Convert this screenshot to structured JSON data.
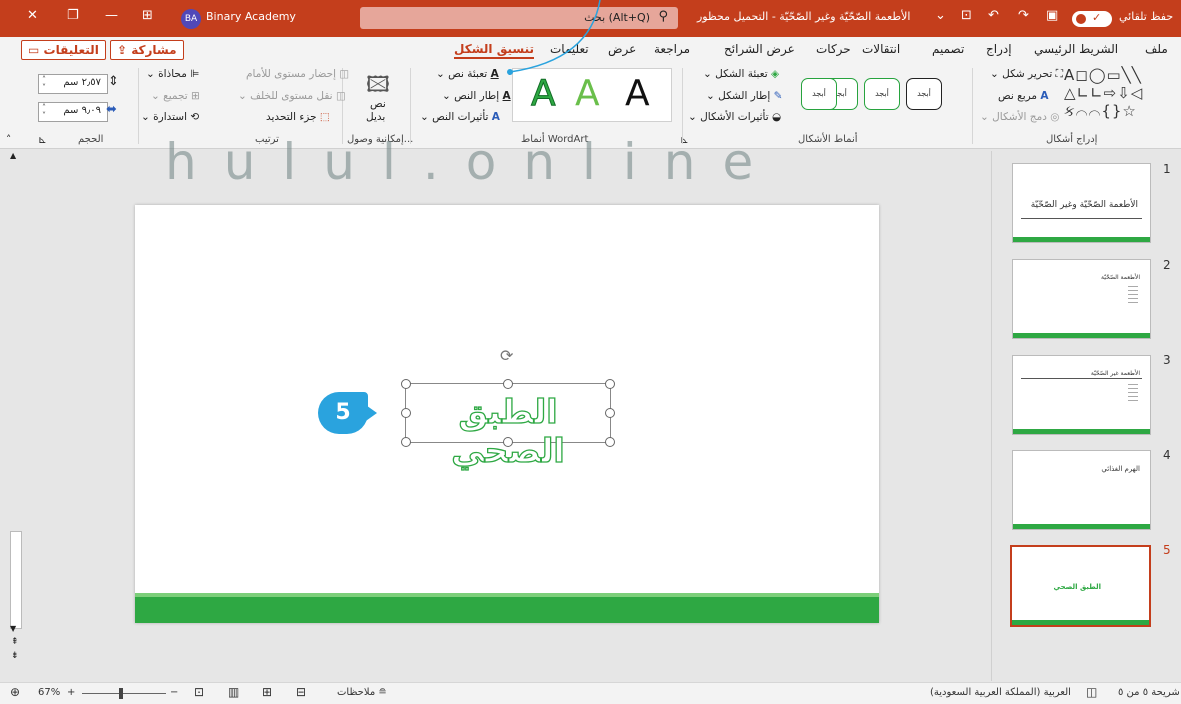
{
  "titlebar": {
    "autosave_label": "حفظ تلقائي",
    "doc_title": "الأطعمة الصّحّيّة وغير الصّحّيّة - التحميل محظور",
    "search_placeholder": "بحث (Alt+Q)",
    "user_name": "Binary Academy",
    "user_initials": "BA"
  },
  "tabs": {
    "share": "مشاركة",
    "comments": "التعليقات",
    "items": [
      "ملف",
      "الشريط الرئيسي",
      "إدراج",
      "تصميم",
      "انتقالات",
      "حركات",
      "عرض الشرائح",
      "مراجعة",
      "عرض",
      "تعليمات",
      "تنسيق الشكل"
    ],
    "active": "تنسيق الشكل"
  },
  "ribbon": {
    "insert_shapes": {
      "edit_shape": "تحرير شكل",
      "text_box": "مربع نص",
      "merge_shapes": "دمج الأشكال",
      "label": "إدراج أشكال"
    },
    "shape_styles": {
      "sample": "أبجد",
      "fill": "تعبئة الشكل",
      "outline": "إطار الشكل",
      "effects": "تأثيرات الأشكال",
      "label": "أنماط الأشكال"
    },
    "wordart": {
      "glyph": "A",
      "text_fill": "تعبئة نص",
      "text_outline": "إطار النص",
      "text_effects": "تأثيرات النص",
      "label": "أنماط WordArt"
    },
    "accessibility": {
      "alt_text_line1": "نص",
      "alt_text_line2": "بديل",
      "label": "إمكانية وصول..."
    },
    "arrange": {
      "bring_forward": "إحضار مستوى للأمام",
      "send_backward": "نقل مستوى للخلف",
      "selection_pane": "جزء التحديد",
      "align": "محاذاة",
      "group": "تجميع",
      "rotate": "استدارة",
      "label": "ترتيب"
    },
    "size": {
      "height": "٢٫٥٧ سم",
      "width": "٩٫٠٩ سم",
      "label": "الحجم"
    }
  },
  "slide": {
    "text": "الطبق الصحي",
    "callout_number": "5"
  },
  "thumbnails": [
    {
      "num": "1",
      "title": "الأطعمة الصّحّيّة وغير الصّحّيّة"
    },
    {
      "num": "2",
      "title": "الأطعمة الصّحّيّة"
    },
    {
      "num": "3",
      "title": "الأطعمة غير الصّحّيّة"
    },
    {
      "num": "4",
      "title": "الهرم الغذائي"
    },
    {
      "num": "5",
      "title": "الطبق الصحي"
    }
  ],
  "statusbar": {
    "slide_count": "شريحة ٥ من ٥",
    "language": "العربية (المملكة العربية السعودية)",
    "notes": "ملاحظات",
    "zoom": "67%"
  },
  "watermark": {
    "text": "hulul.online"
  },
  "colors": {
    "accent": "#c43e1c",
    "green": "#2ea843",
    "callout": "#2aa3de"
  }
}
